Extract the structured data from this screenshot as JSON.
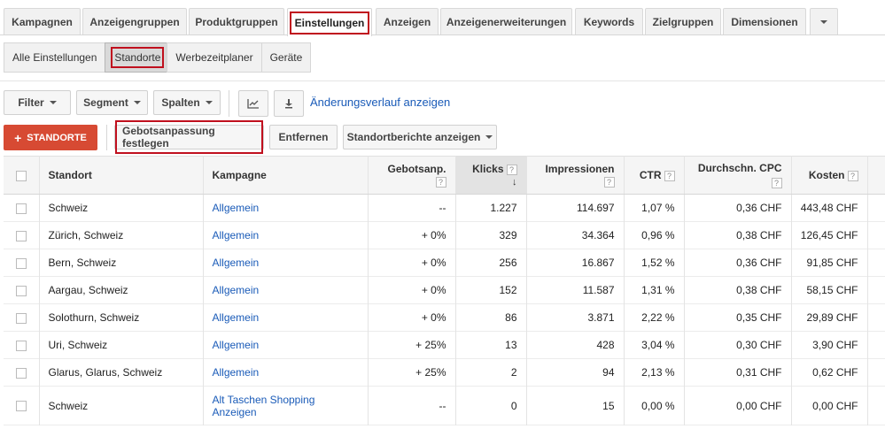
{
  "tabs": [
    {
      "label": "Kampagnen"
    },
    {
      "label": "Anzeigengruppen"
    },
    {
      "label": "Produktgruppen"
    },
    {
      "label": "Einstellungen"
    },
    {
      "label": "Anzeigen"
    },
    {
      "label": "Anzeigenerweiterungen"
    },
    {
      "label": "Keywords"
    },
    {
      "label": "Zielgruppen"
    },
    {
      "label": "Dimensionen"
    }
  ],
  "subtabs": [
    {
      "label": "Alle Einstellungen"
    },
    {
      "label": "Standorte"
    },
    {
      "label": "Werbezeitplaner"
    },
    {
      "label": "Geräte"
    }
  ],
  "toolbar": {
    "filter": "Filter",
    "segment": "Segment",
    "columns": "Spalten",
    "change_history": "Änderungsverlauf anzeigen"
  },
  "actions": {
    "add_locations": "STANDORTE",
    "set_bid_adjustment": "Gebotsanpassung festlegen",
    "remove": "Entfernen",
    "location_reports": "Standortberichte anzeigen"
  },
  "table": {
    "headers": {
      "location": "Standort",
      "campaign": "Kampagne",
      "bid_adj": "Gebotsanp.",
      "clicks": "Klicks",
      "impressions": "Impressionen",
      "ctr": "CTR",
      "avg_cpc": "Durchschn. CPC",
      "cost": "Kosten"
    },
    "rows": [
      {
        "location": "Schweiz",
        "campaign": "Allgemein",
        "bid_adj": "--",
        "clicks": "1.227",
        "impressions": "114.697",
        "ctr": "1,07 %",
        "avg_cpc": "0,36 CHF",
        "cost": "443,48 CHF"
      },
      {
        "location": "Zürich, Schweiz",
        "campaign": "Allgemein",
        "bid_adj": "+ 0%",
        "clicks": "329",
        "impressions": "34.364",
        "ctr": "0,96 %",
        "avg_cpc": "0,38 CHF",
        "cost": "126,45 CHF"
      },
      {
        "location": "Bern, Schweiz",
        "campaign": "Allgemein",
        "bid_adj": "+ 0%",
        "clicks": "256",
        "impressions": "16.867",
        "ctr": "1,52 %",
        "avg_cpc": "0,36 CHF",
        "cost": "91,85 CHF"
      },
      {
        "location": "Aargau, Schweiz",
        "campaign": "Allgemein",
        "bid_adj": "+ 0%",
        "clicks": "152",
        "impressions": "11.587",
        "ctr": "1,31 %",
        "avg_cpc": "0,38 CHF",
        "cost": "58,15 CHF"
      },
      {
        "location": "Solothurn, Schweiz",
        "campaign": "Allgemein",
        "bid_adj": "+ 0%",
        "clicks": "86",
        "impressions": "3.871",
        "ctr": "2,22 %",
        "avg_cpc": "0,35 CHF",
        "cost": "29,89 CHF"
      },
      {
        "location": "Uri, Schweiz",
        "campaign": "Allgemein",
        "bid_adj": "+ 25%",
        "clicks": "13",
        "impressions": "428",
        "ctr": "3,04 %",
        "avg_cpc": "0,30 CHF",
        "cost": "3,90 CHF"
      },
      {
        "location": "Glarus, Glarus, Schweiz",
        "campaign": "Allgemein",
        "bid_adj": "+ 25%",
        "clicks": "2",
        "impressions": "94",
        "ctr": "2,13 %",
        "avg_cpc": "0,31 CHF",
        "cost": "0,62 CHF"
      },
      {
        "location": "Schweiz",
        "campaign": "Alt Taschen Shopping Anzeigen",
        "bid_adj": "--",
        "clicks": "0",
        "impressions": "15",
        "ctr": "0,00 %",
        "avg_cpc": "0,00 CHF",
        "cost": "0,00 CHF"
      }
    ]
  },
  "colors": {
    "accent_red": "#d74a33",
    "highlight_red": "#c0101e",
    "link_blue": "#1a5bb8"
  },
  "icons": {
    "chart": "line-chart-icon",
    "download": "download-icon",
    "more": "chevron-down-icon",
    "sort": "arrow-down-icon",
    "help": "help-icon"
  }
}
